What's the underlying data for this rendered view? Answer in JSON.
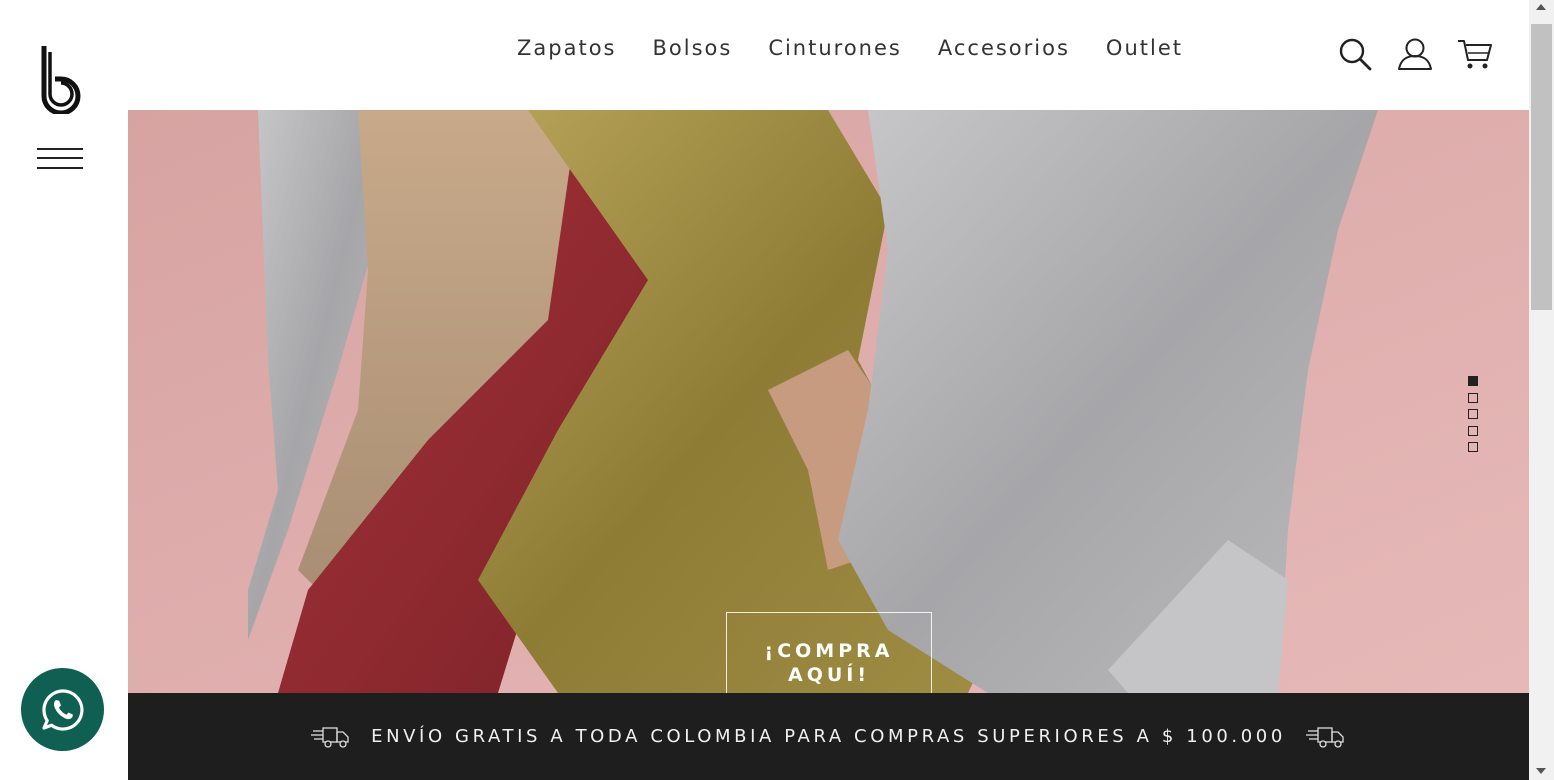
{
  "brand": {
    "logo_letter": "b"
  },
  "nav": {
    "items": [
      {
        "label": "Zapatos"
      },
      {
        "label": "Bolsos"
      },
      {
        "label": "Cinturones"
      },
      {
        "label": "Accesorios"
      },
      {
        "label": "Outlet"
      }
    ]
  },
  "header_icons": [
    "search-icon",
    "user-icon",
    "cart-icon"
  ],
  "hero": {
    "cta_line1": "¡COMPRA",
    "cta_line2": "AQUÍ!",
    "slides_count": 5,
    "active_slide": 1,
    "background_color": "#d9a5a4"
  },
  "banner": {
    "text": "ENVÍO GRATIS A TODA COLOMBIA PARA COMPRAS SUPERIORES A $ 100.000",
    "icon": "truck-icon",
    "background_color": "#1e1e1e"
  },
  "whatsapp": {
    "icon": "whatsapp-icon",
    "color": "#0f5f52"
  }
}
